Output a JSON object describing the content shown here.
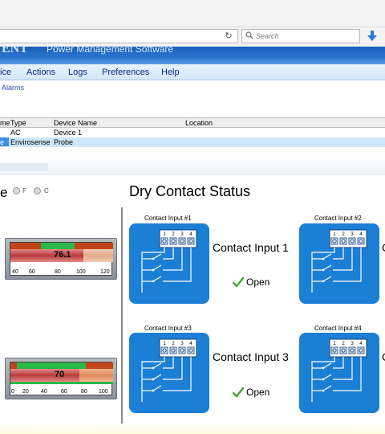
{
  "browser": {
    "search_placeholder": "Search",
    "reload_glyph": "↻"
  },
  "app": {
    "brand_fragment": "ENT",
    "subtitle_fragment": "Power Management Software"
  },
  "menu": {
    "items": [
      {
        "label": "ice"
      },
      {
        "label": "Actions"
      },
      {
        "label": "Logs"
      },
      {
        "label": "Preferences"
      },
      {
        "label": "Help"
      }
    ]
  },
  "breadcrumb": {
    "label": "Alarms"
  },
  "device_table": {
    "headers": [
      "me",
      "Type",
      "Device Name",
      "Location"
    ],
    "rows": [
      [
        "",
        "AC",
        "Device 1",
        ""
      ],
      [
        "e",
        "Envirosense",
        "Probe",
        ""
      ]
    ]
  },
  "unit_selector": {
    "label_fragment": "e",
    "options": [
      "F",
      "C"
    ]
  },
  "gauges": [
    {
      "value": "76.1",
      "ticks": [
        "40",
        "60",
        "80",
        "100",
        "120"
      ],
      "level": 76.1,
      "min": 40,
      "max": 120
    },
    {
      "value": "70",
      "ticks": [
        "0",
        "20",
        "40",
        "60",
        "80",
        "100"
      ],
      "level": 70,
      "min": 0,
      "max": 100
    }
  ],
  "dry_contact": {
    "title": "Dry Contact Status",
    "contacts": [
      {
        "caption": "Contact Input #1",
        "name": "Contact Input 1",
        "status": "Open",
        "pins": [
          "1",
          "2",
          "3",
          "4"
        ]
      },
      {
        "caption": "Contact Input #2",
        "name": "C",
        "status": "",
        "pins": [
          "1",
          "2",
          "3",
          "4"
        ]
      },
      {
        "caption": "Contact Input #3",
        "name": "Contact Input 3",
        "status": "Open",
        "pins": [
          "1",
          "2",
          "3",
          "4"
        ]
      },
      {
        "caption": "Contact Input #4",
        "name": "C",
        "status": "",
        "pins": [
          "1",
          "2",
          "3",
          "4"
        ]
      }
    ]
  },
  "colors": {
    "accent_blue": "#1c7fd6",
    "check_green": "#4aa83a",
    "selected_row": "#cfe6fb"
  }
}
